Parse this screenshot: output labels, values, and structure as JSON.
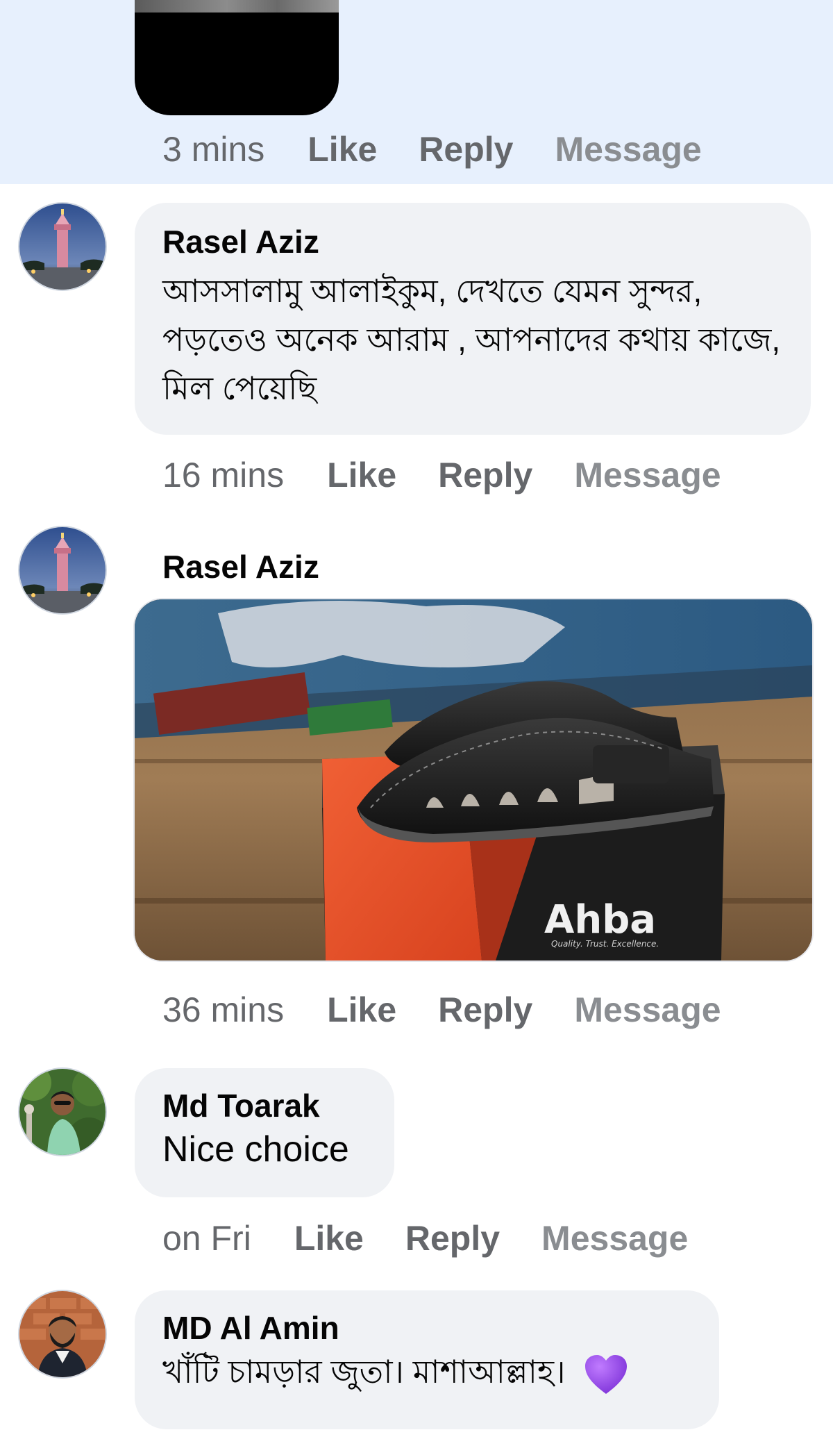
{
  "top_comment": {
    "time": "3 mins",
    "like_label": "Like",
    "reply_label": "Reply",
    "message_label": "Message"
  },
  "comments": [
    {
      "author": "Rasel Aziz",
      "text": "আসসালামু আলাইকুম, দেখতে যেমন সুন্দর, পড়তেও অনেক আরাম , আপনাদের কথায় কাজে, মিল পেয়েছি",
      "time": "16 mins",
      "like_label": "Like",
      "reply_label": "Reply",
      "message_label": "Message"
    },
    {
      "author": "Rasel Aziz",
      "photo_brand_text": "Ahba",
      "photo_tagline": "Quality. Trust. Excellence.",
      "time": "36 mins",
      "like_label": "Like",
      "reply_label": "Reply",
      "message_label": "Message"
    },
    {
      "author": "Md Toarak",
      "text": "Nice choice",
      "time": "on Fri",
      "like_label": "Like",
      "reply_label": "Reply",
      "message_label": "Message"
    },
    {
      "author": "MD Al Amin",
      "text": "খাঁটি চামড়ার জুতা। মাশাআল্লাহ।",
      "emoji_icon": "purple-heart-icon"
    }
  ],
  "colors": {
    "highlight_background": "#e7f0fd",
    "bubble_background": "#f0f2f5",
    "action_text": "#65676b",
    "message_text": "#8a8d91",
    "heart": "#8f3ce6"
  }
}
